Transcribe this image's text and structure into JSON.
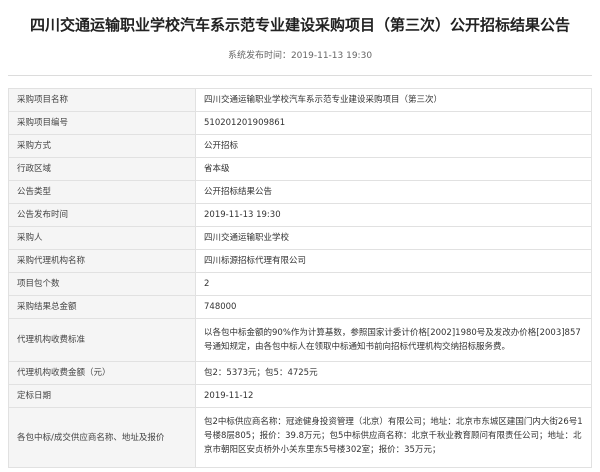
{
  "title": "四川交通运输职业学校汽车系示范专业建设采购项目（第三次）公开招标结果公告",
  "publish_time": "系统发布时间：2019-11-13 19:30",
  "rows": [
    {
      "label": "采购项目名称",
      "value": "四川交通运输职业学校汽车系示范专业建设采购项目（第三次）"
    },
    {
      "label": "采购项目编号",
      "value": "510201201909861"
    },
    {
      "label": "采购方式",
      "value": "公开招标"
    },
    {
      "label": "行政区域",
      "value": "省本级"
    },
    {
      "label": "公告类型",
      "value": "公开招标结果公告"
    },
    {
      "label": "公告发布时间",
      "value": "2019-11-13 19:30"
    },
    {
      "label": "采购人",
      "value": "四川交通运输职业学校"
    },
    {
      "label": "采购代理机构名称",
      "value": "四川标源招标代理有限公司"
    },
    {
      "label": "项目包个数",
      "value": "2"
    },
    {
      "label": "采购结果总金额",
      "value": "748000"
    },
    {
      "label": "代理机构收费标准",
      "value": "以各包中标金额的90%作为计算基数，参照国家计委计价格[2002]1980号及发改办价格[2003]857号通知规定，由各包中标人在领取中标通知书前向招标代理机构交纳招标服务费。"
    },
    {
      "label": "代理机构收费金额（元）",
      "value": "包2：5373元；包5：4725元"
    },
    {
      "label": "定标日期",
      "value": "2019-11-12"
    },
    {
      "label": "各包中标/成交供应商名称、地址及报价",
      "value": "包2中标供应商名称：冠途健身投资管理（北京）有限公司；地址：北京市东城区建国门内大街26号1号楼8层805；报价：39.8万元；包5中标供应商名称：北京千秋业教育顾问有限责任公司；地址：北京市朝阳区安贞桥外小关东里东5号楼302室；报价：35万元；"
    }
  ]
}
